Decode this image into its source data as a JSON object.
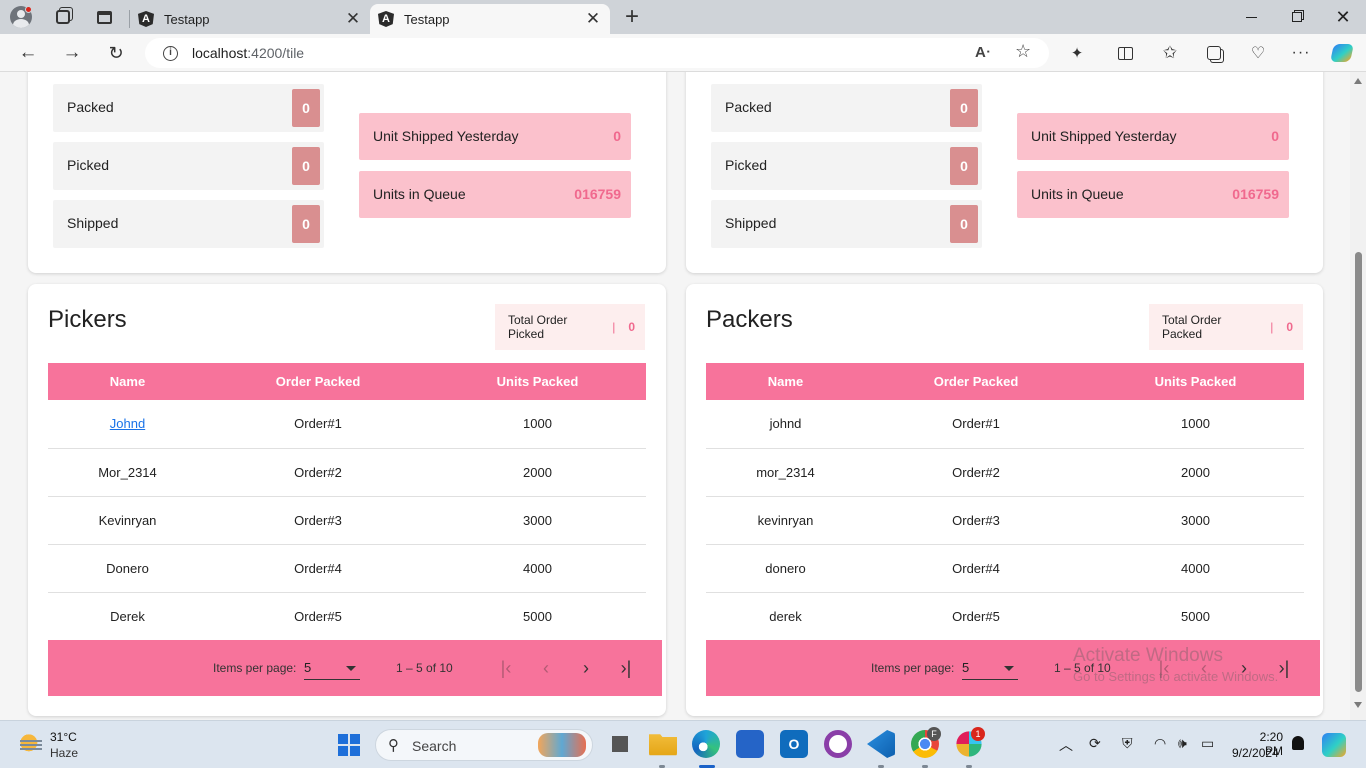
{
  "browser": {
    "tabs": [
      {
        "title": "Testapp",
        "active": false
      },
      {
        "title": "Testapp",
        "active": true
      }
    ],
    "url_host": "localhost",
    "url_path": ":4200/tile"
  },
  "top_panels": [
    {
      "status": [
        {
          "label": "Packed",
          "count": "0"
        },
        {
          "label": "Picked",
          "count": "0"
        },
        {
          "label": "Shipped",
          "count": "0"
        }
      ],
      "metrics": [
        {
          "label": "Unit Shipped Yesterday",
          "value": "0"
        },
        {
          "label": "Units in Queue",
          "value": "016759"
        }
      ]
    },
    {
      "status": [
        {
          "label": "Packed",
          "count": "0"
        },
        {
          "label": "Picked",
          "count": "0"
        },
        {
          "label": "Shipped",
          "count": "0"
        }
      ],
      "metrics": [
        {
          "label": "Unit Shipped Yesterday",
          "value": "0"
        },
        {
          "label": "Units in Queue",
          "value": "016759"
        }
      ]
    }
  ],
  "pickers": {
    "title": "Pickers",
    "total_label": "Total Order Picked",
    "total_sep": "|",
    "total_value": "0",
    "columns": [
      "Name",
      "Order Packed",
      "Units Packed"
    ],
    "rows": [
      [
        "Johnd",
        "Order#1",
        "1000"
      ],
      [
        "Mor_2314",
        "Order#2",
        "2000"
      ],
      [
        "Kevinryan",
        "Order#3",
        "3000"
      ],
      [
        "Donero",
        "Order#4",
        "4000"
      ],
      [
        "Derek",
        "Order#5",
        "5000"
      ]
    ]
  },
  "packers": {
    "title": "Packers",
    "total_label": "Total Order Packed",
    "total_sep": "|",
    "total_value": "0",
    "columns": [
      "Name",
      "Order Packed",
      "Units Packed"
    ],
    "rows": [
      [
        "johnd",
        "Order#1",
        "1000"
      ],
      [
        "mor_2314",
        "Order#2",
        "2000"
      ],
      [
        "kevinryan",
        "Order#3",
        "3000"
      ],
      [
        "donero",
        "Order#4",
        "4000"
      ],
      [
        "derek",
        "Order#5",
        "5000"
      ]
    ]
  },
  "paginator": {
    "items_per_page_label": "Items per page:",
    "page_size": "5",
    "range": "1 – 5 of 10"
  },
  "watermark": {
    "line1": "Activate Windows",
    "line2": "Go to Settings to activate Windows."
  },
  "taskbar": {
    "temperature": "31°C",
    "condition": "Haze",
    "search_label": "Search",
    "outlook_letter": "O",
    "chrome_badge": "F",
    "slack_badge": "1",
    "time": "2:20 PM",
    "date": "9/2/2024"
  },
  "colors": {
    "accent_pink": "#f7739b",
    "metric_bg": "#fbc1cc",
    "count_bg": "#d98f90",
    "value_text": "#f0698e"
  }
}
